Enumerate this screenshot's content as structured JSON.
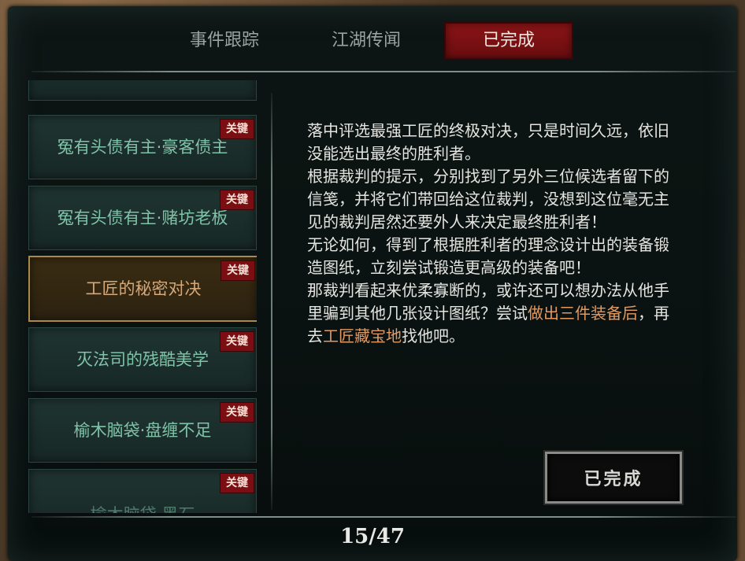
{
  "tabs": [
    {
      "label": "事件跟踪",
      "active": false
    },
    {
      "label": "江湖传闻",
      "active": false
    },
    {
      "label": "已完成",
      "active": true
    }
  ],
  "quest_list": [
    {
      "title": "冤有头债有主·豪客债主",
      "badge": "关键",
      "selected": false
    },
    {
      "title": "冤有头债有主·赌坊老板",
      "badge": "关键",
      "selected": false
    },
    {
      "title": "工匠的秘密对决",
      "badge": "关键",
      "selected": true
    },
    {
      "title": "灭法司的残酷美学",
      "badge": "关键",
      "selected": false
    },
    {
      "title": "榆木脑袋·盘缠不足",
      "badge": "关键",
      "selected": false
    },
    {
      "title": "榆木脑袋·黑石",
      "badge": "关键",
      "selected": false
    }
  ],
  "description": {
    "p1": "落中评选最强工匠的终极对决，只是时间久远，依旧没能选出最终的胜利者。",
    "p2": "根据裁判的提示，分别找到了另外三位候选者留下的信笺，并将它们带回给这位裁判，没想到这位毫无主见的裁判居然还要外人来决定最终胜利者！",
    "p3": "无论如何，得到了根据胜利者的理念设计出的装备锻造图纸，立刻尝试锻造更高级的装备吧！",
    "p4_a": "那裁判看起来优柔寡断的，或许还可以想办法从他手里骗到其他几张设计图纸？尝试",
    "p4_hl1": "做出三件装备后",
    "p4_b": "，再去",
    "p4_hl2": "工匠藏宝地",
    "p4_c": "找他吧。"
  },
  "status_button": "已完成",
  "pagination": "15/47",
  "colors": {
    "accent_red": "#7a0e12",
    "highlight": "#e09a62",
    "quest_text": "#7fc3a8"
  }
}
